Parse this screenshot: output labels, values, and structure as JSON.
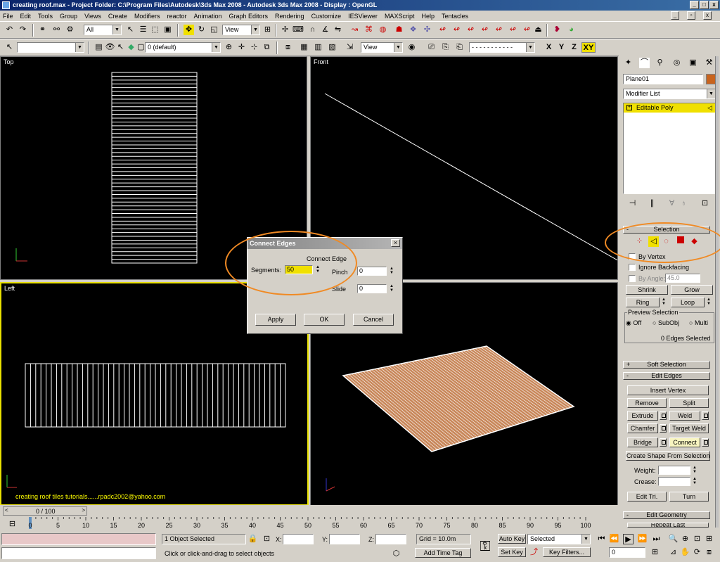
{
  "window": {
    "title": "creating roof.max    - Project Folder: C:\\Program Files\\Autodesk\\3ds Max 2008      - Autodesk 3ds Max 2008      - Display : OpenGL"
  },
  "menu": [
    "File",
    "Edit",
    "Tools",
    "Group",
    "Views",
    "Create",
    "Modifiers",
    "reactor",
    "Animation",
    "Graph Editors",
    "Rendering",
    "Customize",
    "IESViewer",
    "MAXScript",
    "Help",
    "Tentacles"
  ],
  "toolbar": {
    "selection_filter": "All",
    "ref_coord": "View",
    "layer": "0 (default)",
    "view2": "View",
    "axis_x": "X",
    "axis_y": "Y",
    "axis_z": "Z",
    "axis_xy": "XY"
  },
  "viewports": {
    "top": "Top",
    "front": "Front",
    "left": "Left",
    "credit": "creating roof tiles tutorials......rpadc2002@yahoo.com"
  },
  "dialog": {
    "title": "Connect Edges",
    "group": "Connect Edge",
    "segments_label": "Segments:",
    "segments_value": "50",
    "pinch_label": "Pinch",
    "pinch_value": "0",
    "slide_label": "Slide",
    "slide_value": "0",
    "apply": "Apply",
    "ok": "OK",
    "cancel": "Cancel"
  },
  "panel": {
    "object_name": "Plane01",
    "modifier_list": "Modifier List",
    "stack_item": "Editable Poly",
    "selection_title": "Selection",
    "by_vertex": "By Vertex",
    "ignore_backfacing": "Ignore Backfacing",
    "by_angle": "By Angle:",
    "by_angle_value": "45.0",
    "shrink": "Shrink",
    "grow": "Grow",
    "ring": "Ring",
    "loop": "Loop",
    "preview_selection": "Preview Selection",
    "off": "Off",
    "subobj": "SubObj",
    "multi": "Multi",
    "edges_selected": "0 Edges Selected",
    "soft_selection": "Soft Selection",
    "edit_edges": "Edit Edges",
    "insert_vertex": "Insert Vertex",
    "remove": "Remove",
    "split": "Split",
    "extrude": "Extrude",
    "weld": "Weld",
    "chamfer": "Chamfer",
    "target_weld": "Target Weld",
    "bridge": "Bridge",
    "connect": "Connect",
    "create_shape": "Create Shape From Selection",
    "weight": "Weight:",
    "crease": "Crease:",
    "edit_tri": "Edit Tri.",
    "turn": "Turn",
    "edit_geometry": "Edit Geometry",
    "repeat_last": "Repeat Last"
  },
  "timeline": {
    "frame": "0 / 100",
    "ticks": [
      "0",
      "5",
      "10",
      "15",
      "20",
      "25",
      "30",
      "35",
      "40",
      "45",
      "50",
      "55",
      "60",
      "65",
      "70",
      "75",
      "80",
      "85",
      "90",
      "95",
      "100"
    ]
  },
  "status": {
    "selected": "1 Object Selected",
    "prompt": "Click or click-and-drag to select objects",
    "x_label": "X:",
    "y_label": "Y:",
    "z_label": "Z:",
    "grid": "Grid = 10.0m",
    "add_time_tag": "Add Time Tag",
    "auto_key": "Auto Key",
    "set_key": "Set Key",
    "key_mode": "Selected",
    "key_filters": "Key Filters...",
    "frame_field": "0"
  },
  "colors": {
    "highlight": "#f0e000",
    "annotation": "#f08a24",
    "plane": "#c8875a",
    "swatch": "#c8641e"
  }
}
